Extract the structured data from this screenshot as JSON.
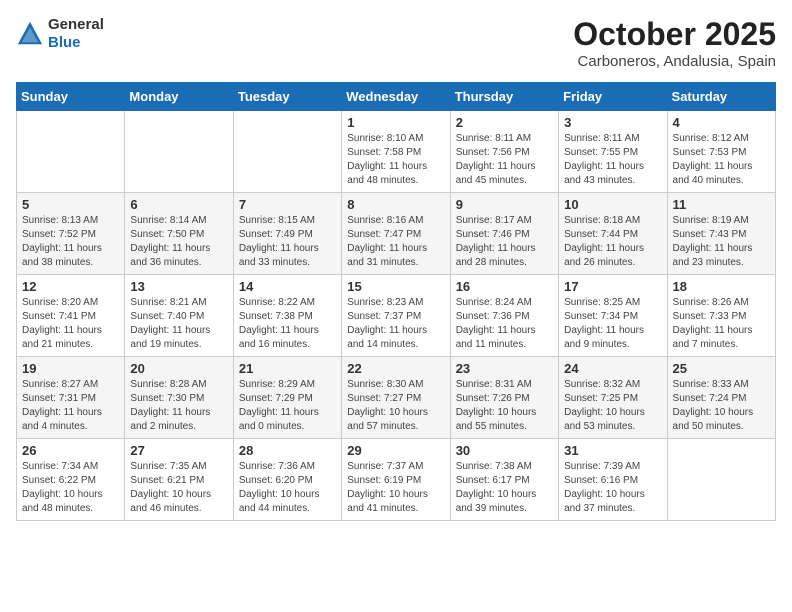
{
  "logo": {
    "general": "General",
    "blue": "Blue"
  },
  "header": {
    "month": "October 2025",
    "location": "Carboneros, Andalusia, Spain"
  },
  "weekdays": [
    "Sunday",
    "Monday",
    "Tuesday",
    "Wednesday",
    "Thursday",
    "Friday",
    "Saturday"
  ],
  "weeks": [
    [
      {
        "day": "",
        "info": ""
      },
      {
        "day": "",
        "info": ""
      },
      {
        "day": "",
        "info": ""
      },
      {
        "day": "1",
        "info": "Sunrise: 8:10 AM\nSunset: 7:58 PM\nDaylight: 11 hours and 48 minutes."
      },
      {
        "day": "2",
        "info": "Sunrise: 8:11 AM\nSunset: 7:56 PM\nDaylight: 11 hours and 45 minutes."
      },
      {
        "day": "3",
        "info": "Sunrise: 8:11 AM\nSunset: 7:55 PM\nDaylight: 11 hours and 43 minutes."
      },
      {
        "day": "4",
        "info": "Sunrise: 8:12 AM\nSunset: 7:53 PM\nDaylight: 11 hours and 40 minutes."
      }
    ],
    [
      {
        "day": "5",
        "info": "Sunrise: 8:13 AM\nSunset: 7:52 PM\nDaylight: 11 hours and 38 minutes."
      },
      {
        "day": "6",
        "info": "Sunrise: 8:14 AM\nSunset: 7:50 PM\nDaylight: 11 hours and 36 minutes."
      },
      {
        "day": "7",
        "info": "Sunrise: 8:15 AM\nSunset: 7:49 PM\nDaylight: 11 hours and 33 minutes."
      },
      {
        "day": "8",
        "info": "Sunrise: 8:16 AM\nSunset: 7:47 PM\nDaylight: 11 hours and 31 minutes."
      },
      {
        "day": "9",
        "info": "Sunrise: 8:17 AM\nSunset: 7:46 PM\nDaylight: 11 hours and 28 minutes."
      },
      {
        "day": "10",
        "info": "Sunrise: 8:18 AM\nSunset: 7:44 PM\nDaylight: 11 hours and 26 minutes."
      },
      {
        "day": "11",
        "info": "Sunrise: 8:19 AM\nSunset: 7:43 PM\nDaylight: 11 hours and 23 minutes."
      }
    ],
    [
      {
        "day": "12",
        "info": "Sunrise: 8:20 AM\nSunset: 7:41 PM\nDaylight: 11 hours and 21 minutes."
      },
      {
        "day": "13",
        "info": "Sunrise: 8:21 AM\nSunset: 7:40 PM\nDaylight: 11 hours and 19 minutes."
      },
      {
        "day": "14",
        "info": "Sunrise: 8:22 AM\nSunset: 7:38 PM\nDaylight: 11 hours and 16 minutes."
      },
      {
        "day": "15",
        "info": "Sunrise: 8:23 AM\nSunset: 7:37 PM\nDaylight: 11 hours and 14 minutes."
      },
      {
        "day": "16",
        "info": "Sunrise: 8:24 AM\nSunset: 7:36 PM\nDaylight: 11 hours and 11 minutes."
      },
      {
        "day": "17",
        "info": "Sunrise: 8:25 AM\nSunset: 7:34 PM\nDaylight: 11 hours and 9 minutes."
      },
      {
        "day": "18",
        "info": "Sunrise: 8:26 AM\nSunset: 7:33 PM\nDaylight: 11 hours and 7 minutes."
      }
    ],
    [
      {
        "day": "19",
        "info": "Sunrise: 8:27 AM\nSunset: 7:31 PM\nDaylight: 11 hours and 4 minutes."
      },
      {
        "day": "20",
        "info": "Sunrise: 8:28 AM\nSunset: 7:30 PM\nDaylight: 11 hours and 2 minutes."
      },
      {
        "day": "21",
        "info": "Sunrise: 8:29 AM\nSunset: 7:29 PM\nDaylight: 11 hours and 0 minutes."
      },
      {
        "day": "22",
        "info": "Sunrise: 8:30 AM\nSunset: 7:27 PM\nDaylight: 10 hours and 57 minutes."
      },
      {
        "day": "23",
        "info": "Sunrise: 8:31 AM\nSunset: 7:26 PM\nDaylight: 10 hours and 55 minutes."
      },
      {
        "day": "24",
        "info": "Sunrise: 8:32 AM\nSunset: 7:25 PM\nDaylight: 10 hours and 53 minutes."
      },
      {
        "day": "25",
        "info": "Sunrise: 8:33 AM\nSunset: 7:24 PM\nDaylight: 10 hours and 50 minutes."
      }
    ],
    [
      {
        "day": "26",
        "info": "Sunrise: 7:34 AM\nSunset: 6:22 PM\nDaylight: 10 hours and 48 minutes."
      },
      {
        "day": "27",
        "info": "Sunrise: 7:35 AM\nSunset: 6:21 PM\nDaylight: 10 hours and 46 minutes."
      },
      {
        "day": "28",
        "info": "Sunrise: 7:36 AM\nSunset: 6:20 PM\nDaylight: 10 hours and 44 minutes."
      },
      {
        "day": "29",
        "info": "Sunrise: 7:37 AM\nSunset: 6:19 PM\nDaylight: 10 hours and 41 minutes."
      },
      {
        "day": "30",
        "info": "Sunrise: 7:38 AM\nSunset: 6:17 PM\nDaylight: 10 hours and 39 minutes."
      },
      {
        "day": "31",
        "info": "Sunrise: 7:39 AM\nSunset: 6:16 PM\nDaylight: 10 hours and 37 minutes."
      },
      {
        "day": "",
        "info": ""
      }
    ]
  ]
}
